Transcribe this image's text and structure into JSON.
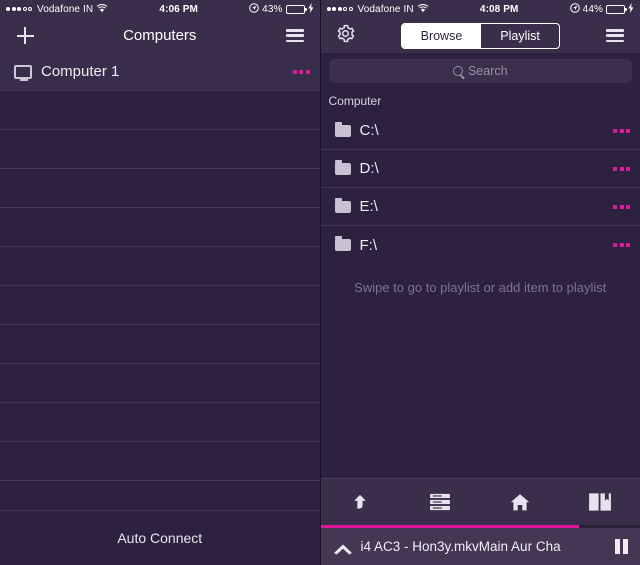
{
  "accent_pink": "#D81B9B",
  "background": "#2E2140",
  "navbar_background": "#3B2E4A",
  "left_panel": {
    "status_bar": {
      "carrier": "Vodafone IN",
      "signal_dots_filled": 3,
      "signal_dots_total": 5,
      "wifi_icon": "wifi-icon",
      "time": "4:06 PM",
      "location_icon": "location-arrow-icon",
      "battery_percent": "43%",
      "battery_level": 43,
      "charging_icon": "lightning-bolt-icon"
    },
    "navbar": {
      "add_icon": "plus-icon",
      "title": "Computers",
      "menu_icon": "hamburger-menu-icon"
    },
    "computers": [
      {
        "icon": "monitor-icon",
        "name": "Computer 1",
        "more_icon": "ellipsis-icon"
      }
    ],
    "empty_row_count": 11,
    "footer": {
      "auto_connect_label": "Auto Connect"
    }
  },
  "right_panel": {
    "status_bar": {
      "carrier": "Vodafone IN",
      "signal_dots_filled": 3,
      "signal_dots_total": 5,
      "wifi_icon": "wifi-icon",
      "time": "4:08 PM",
      "location_icon": "location-arrow-icon",
      "battery_percent": "44%",
      "battery_level": 44,
      "charging_icon": "lightning-bolt-icon"
    },
    "navbar": {
      "settings_icon": "gear-icon",
      "segments": [
        {
          "label": "Browse",
          "selected": true
        },
        {
          "label": "Playlist",
          "selected": false
        }
      ],
      "menu_icon": "hamburger-menu-icon"
    },
    "search": {
      "icon": "search-icon",
      "placeholder": "Search",
      "value": ""
    },
    "section_header": "Computer",
    "drives": [
      {
        "icon": "folder-icon",
        "name": "C:\\",
        "more_icon": "ellipsis-icon"
      },
      {
        "icon": "folder-icon",
        "name": "D:\\",
        "more_icon": "ellipsis-icon"
      },
      {
        "icon": "folder-icon",
        "name": "E:\\",
        "more_icon": "ellipsis-icon"
      },
      {
        "icon": "folder-icon",
        "name": "F:\\",
        "more_icon": "ellipsis-icon"
      }
    ],
    "hint": "Swipe to go to playlist or add item to playlist",
    "tabbar": [
      {
        "icon": "up-arrow-icon",
        "name": "tab-go-up"
      },
      {
        "icon": "list-icon",
        "name": "tab-playlist"
      },
      {
        "icon": "home-icon",
        "name": "tab-home"
      },
      {
        "icon": "book-bookmark-icon",
        "name": "tab-library"
      }
    ],
    "now_playing": {
      "expand_icon": "chevron-up-icon",
      "title": "i4 AC3 - Hon3y.mkvMain Aur Cha",
      "pause_icon": "pause-icon",
      "progress_percent": 81
    }
  }
}
